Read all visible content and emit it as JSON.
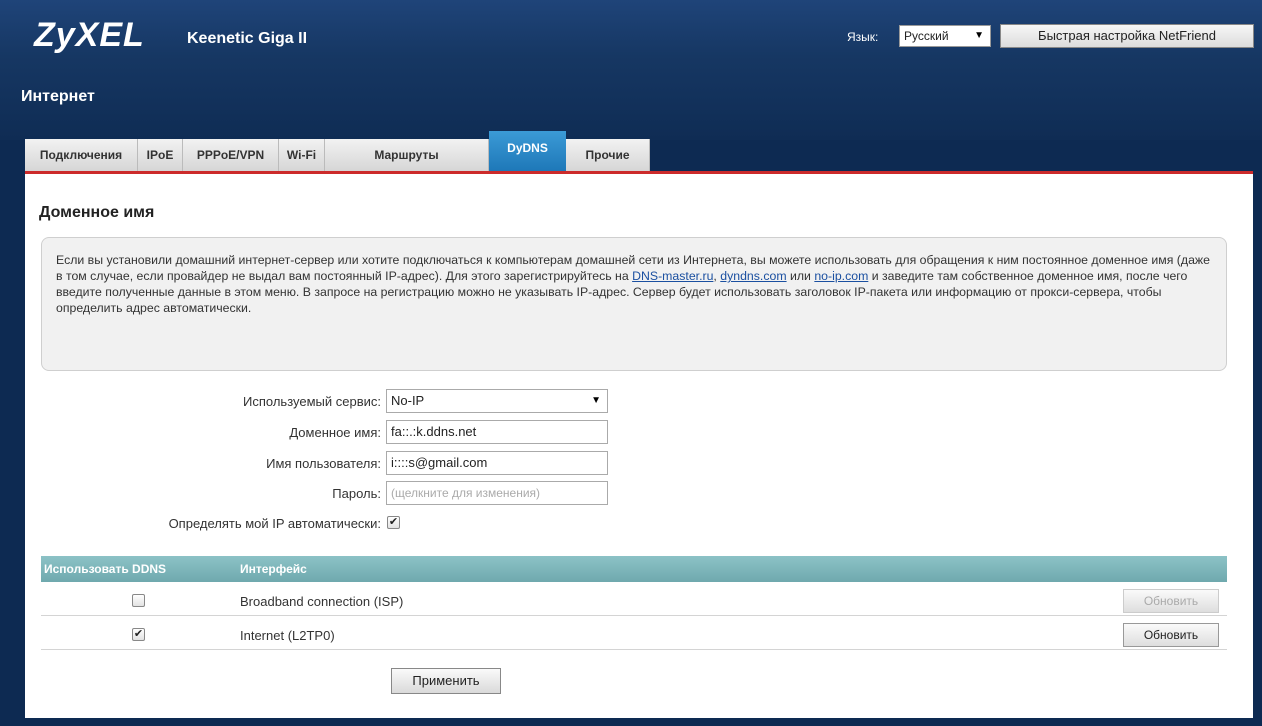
{
  "header": {
    "brand": "ZyXEL",
    "model": "Keenetic Giga II",
    "language_label": "Язык:",
    "language_value": "Русский",
    "netfriend_button": "Быстрая настройка NetFriend"
  },
  "section": {
    "title": "Интернет"
  },
  "tabs": [
    {
      "label": "Подключения",
      "active": false
    },
    {
      "label": "IPoE",
      "active": false
    },
    {
      "label": "PPPoE/VPN",
      "active": false
    },
    {
      "label": "Wi-Fi",
      "active": false
    },
    {
      "label": "Маршруты",
      "active": false
    },
    {
      "label": "DyDNS",
      "active": true
    },
    {
      "label": "Прочие",
      "active": false
    }
  ],
  "page": {
    "heading": "Доменное имя",
    "info": {
      "part1": "Если вы установили домашний интернет-сервер или хотите подключаться к компьютерам домашней сети из Интернета, вы можете использовать для обращения к ним постоянное доменное имя (даже в том случае, если провайдер не выдал вам постоянный IP-адрес). Для этого зарегистрируйтесь на ",
      "link1": "DNS-master.ru",
      "sep1": ", ",
      "link2": "dyndns.com",
      "sep2": " или ",
      "link3": "no-ip.com",
      "part2": " и заведите там собственное доменное имя, после чего введите полученные данные в этом меню. В запросе на регистрацию можно не указывать IP-адрес. Сервер будет использовать заголовок IP-пакета или информацию от прокси-сервера, чтобы определить адрес автоматически."
    }
  },
  "form": {
    "service_label": "Используемый сервис:",
    "service_value": "No-IP",
    "domain_label": "Доменное имя:",
    "domain_value": "fa::.:k.ddns.net",
    "user_label": "Имя пользователя:",
    "user_value": "i::::s@gmail.com",
    "password_label": "Пароль:",
    "password_placeholder": "(щелкните для изменения)",
    "autoip_label": "Определять мой IP автоматически:",
    "autoip_checked": true
  },
  "ddns_table": {
    "columns": [
      "Использовать DDNS",
      "Интерфейс"
    ],
    "rows": [
      {
        "enabled": false,
        "interface": "Broadband connection (ISP)",
        "button": "Обновить",
        "button_disabled": true
      },
      {
        "enabled": true,
        "interface": "Internet (L2TP0)",
        "button": "Обновить",
        "button_disabled": false
      }
    ]
  },
  "apply_button": "Применить"
}
